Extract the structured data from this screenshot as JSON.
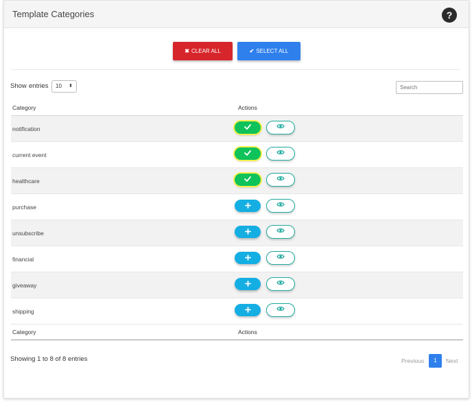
{
  "header": {
    "title": "Template Categories",
    "help_label": "?"
  },
  "toolbar": {
    "clear_all_icon": "✖",
    "clear_all_label": "CLEAR ALL",
    "select_all_icon": "✔",
    "select_all_label": "SELECT ALL"
  },
  "table_controls": {
    "show_label_before": "Show",
    "show_label_after": "entries",
    "entries_value": "10",
    "search_placeholder": "Search"
  },
  "table": {
    "columns": [
      "Category",
      "Actions"
    ],
    "footer_columns": [
      "Category",
      "Actions"
    ],
    "rows": [
      {
        "category": "notification",
        "state": "selected"
      },
      {
        "category": "current event",
        "state": "selected"
      },
      {
        "category": "healthcare",
        "state": "selected"
      },
      {
        "category": "purchase",
        "state": "add"
      },
      {
        "category": "unsubscribe",
        "state": "add"
      },
      {
        "category": "financial",
        "state": "add"
      },
      {
        "category": "giveaway",
        "state": "add"
      },
      {
        "category": "shipping",
        "state": "add"
      }
    ]
  },
  "pagination": {
    "info": "Showing 1 to 8 of 8 entries",
    "previous_label": "Previous",
    "current_page": "1",
    "next_label": "Next"
  },
  "icons": {
    "selected": "check-icon",
    "add": "plus-icon",
    "view": "eye-icon"
  },
  "colors": {
    "clear_all": "#d7262b",
    "select_all": "#2f80ed",
    "selected_button": "#0fc25a",
    "selected_outline": "#f5f04f",
    "add_button": "#14aee3",
    "view_outline": "#1ea99e"
  }
}
